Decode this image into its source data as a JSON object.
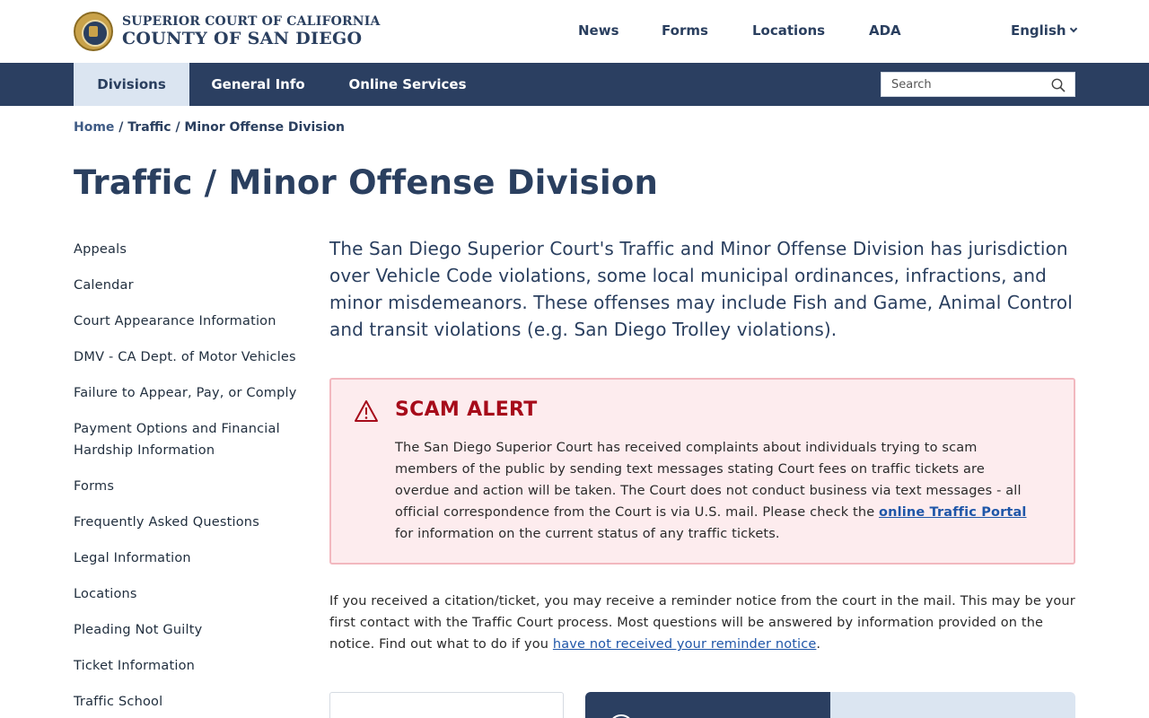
{
  "header": {
    "logo_line1": "Superior Court of California",
    "logo_line2": "County of San Diego",
    "links": [
      "News",
      "Forms",
      "Locations",
      "ADA"
    ],
    "language": "English"
  },
  "nav": {
    "tabs": [
      "Divisions",
      "General Info",
      "Online Services"
    ],
    "active_tab": "Divisions",
    "search_placeholder": "Search"
  },
  "breadcrumb": {
    "home": "Home",
    "separator": "/",
    "current": "Traffic / Minor Offense Division"
  },
  "page_title": "Traffic / Minor Offense Division",
  "sidebar": {
    "items": [
      "Appeals",
      "Calendar",
      "Court Appearance Information",
      "DMV - CA Dept. of Motor Vehicles",
      "Failure to Appear, Pay, or Comply",
      "Payment Options and Financial Hardship Information",
      "Forms",
      "Frequently Asked Questions",
      "Legal Information",
      "Locations",
      "Pleading Not Guilty",
      "Ticket Information",
      "Traffic School"
    ]
  },
  "intro": "The San Diego Superior Court's Traffic and Minor Offense Division has jurisdiction over Vehicle Code violations, some local municipal ordinances, infractions, and minor misdemeanors. These offenses may include Fish and Game, Animal Control and transit violations (e.g. San Diego Trolley violations).",
  "alert": {
    "title": "SCAM ALERT",
    "body_before": "The San Diego Superior Court has received complaints about individuals trying to scam members of the public by sending text messages stating Court fees on traffic tickets are overdue and action will be taken. The Court does not conduct business via text messages - all official correspondence from the Court is via U.S. mail. Please check the ",
    "link_text": "online Traffic Portal",
    "body_after": " for information on the current status of any traffic tickets."
  },
  "reminder": {
    "text_before": "If you received a citation/ticket, you may receive a reminder notice from the court in the mail. This may be your first contact with the Traffic Court process. Most questions will be answered by information provided on the notice. Find out what to do if you ",
    "link_text": "have not received your reminder notice",
    "text_after": "."
  },
  "colors": {
    "navy": "#2b3f61",
    "active_tab_bg": "#dbe5f1",
    "alert_bg": "#fdecee",
    "alert_border": "#f2b8bf",
    "alert_red": "#a60b1a",
    "link": "#1f56a8"
  },
  "icons": {
    "seal": "court-seal-logo",
    "search": "search-icon",
    "alert": "warning-triangle-icon",
    "language": "chevron-down-icon"
  }
}
